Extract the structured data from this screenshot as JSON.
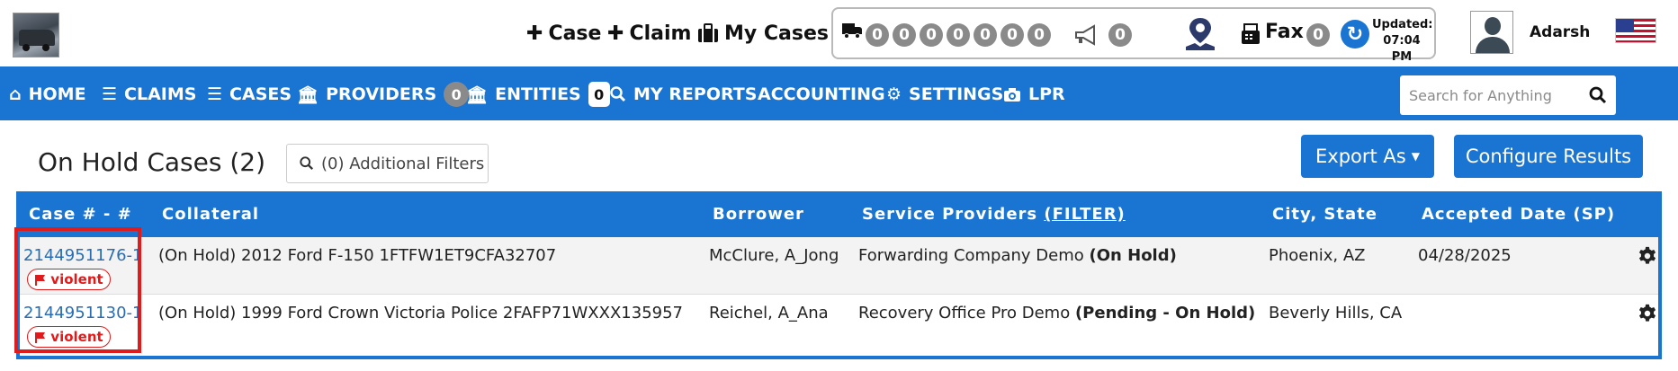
{
  "header": {
    "quick_links": [
      {
        "icon": "plus-icon",
        "label": "Case"
      },
      {
        "icon": "plus-icon",
        "label": "Claim"
      },
      {
        "icon": "briefcase-icon",
        "label": "My Cases"
      }
    ],
    "counters": [
      "0",
      "0",
      "0",
      "0",
      "0",
      "0",
      "0"
    ],
    "announcement_count": "0",
    "fax_label": "Fax",
    "fax_count": "0",
    "updated_label": "Updated:",
    "updated_time": "07:04 PM",
    "username": "Adarsh"
  },
  "nav": {
    "items": [
      {
        "icon": "home-icon",
        "label": "HOME"
      },
      {
        "icon": "menu-icon",
        "label": "CLAIMS"
      },
      {
        "icon": "menu-icon",
        "label": "CASES"
      },
      {
        "icon": "bank-icon",
        "label": "PROVIDERS",
        "badge": "0"
      },
      {
        "icon": "bank-icon",
        "label": "ENTITIES",
        "badge": "0"
      },
      {
        "icon": "search-icon",
        "label": "MY REPORTS"
      },
      {
        "icon": "",
        "label": "ACCOUNTING"
      },
      {
        "icon": "gear-icon",
        "label": "SETTINGS"
      },
      {
        "icon": "camera-icon",
        "label": "LPR"
      }
    ],
    "search_placeholder": "Search for Anything"
  },
  "page": {
    "title": "On Hold Cases (2)",
    "filter_button": "(0) Additional Filters",
    "export_button": "Export As",
    "configure_button": "Configure Results"
  },
  "table": {
    "headers": {
      "case": "Case # - #",
      "collateral": "Collateral",
      "borrower": "Borrower",
      "service_providers": "Service Providers",
      "filter_link": "(FILTER)",
      "city_state": "City, State",
      "accepted_date": "Accepted Date (SP)"
    },
    "rows": [
      {
        "case": "2144951176-1",
        "tag": "violent",
        "collateral": "(On Hold) 2012 Ford F-150 1FTFW1ET9CFA32707",
        "borrower": "McClure, A_Jong",
        "provider": "Forwarding Company Demo",
        "provider_status": "(On Hold)",
        "city_state": "Phoenix, AZ",
        "accepted_date": "04/28/2025"
      },
      {
        "case": "2144951130-1",
        "tag": "violent",
        "collateral": "(On Hold) 1999 Ford Crown Victoria Police 2FAFP71WXXX135957",
        "borrower": "Reichel, A_Ana",
        "provider": "Recovery Office Pro Demo",
        "provider_status": "(Pending - On Hold)",
        "city_state": "Beverly Hills, CA",
        "accepted_date": ""
      }
    ]
  },
  "colors": {
    "brand_blue": "#1a74d2",
    "badge_gray": "#8a8a8a",
    "alert_red": "#e01b1b",
    "link_blue": "#2a6db3"
  }
}
